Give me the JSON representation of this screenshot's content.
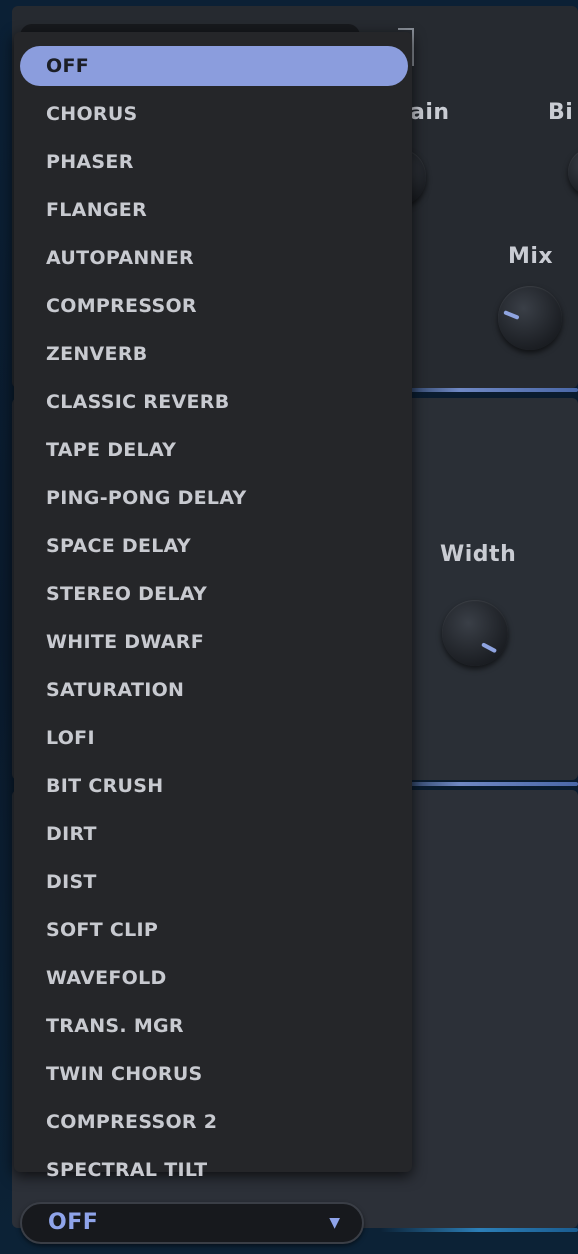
{
  "background_panel": {
    "labels": {
      "gain": "ain",
      "bit": "Bi",
      "mix": "Mix",
      "width": "Width"
    },
    "knob_levels": {
      "mix": 0.12,
      "width": 0.85
    },
    "accent_color": "#8b9ddd"
  },
  "effect_dropdown": {
    "options": [
      "OFF",
      "CHORUS",
      "PHASER",
      "FLANGER",
      "AUTOPANNER",
      "COMPRESSOR",
      "ZENVERB",
      "CLASSIC REVERB",
      "TAPE DELAY",
      "PING-PONG DELAY",
      "SPACE DELAY",
      "STEREO DELAY",
      "WHITE DWARF",
      "SATURATION",
      "LOFI",
      "BIT CRUSH",
      "DIRT",
      "DIST",
      "SOFT CLIP",
      "WAVEFOLD",
      "TRANS. MGR",
      "TWIN CHORUS",
      "COMPRESSOR 2",
      "SPECTRAL TILT"
    ],
    "selected": "OFF",
    "selected_color": "#8b9ddd"
  },
  "effect_select": {
    "value": "OFF",
    "arrow_icon": "triangle-down-icon"
  }
}
